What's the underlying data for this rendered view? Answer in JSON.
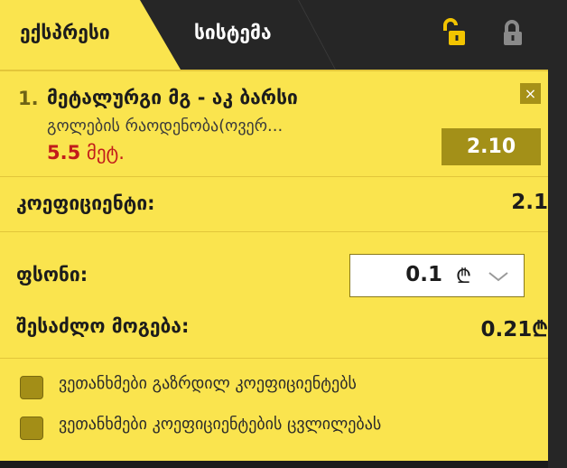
{
  "tabs": {
    "express": "ექსპრესი",
    "system": "სისტემა"
  },
  "icons": {
    "unlock": "unlock-icon",
    "lock": "lock-icon",
    "close": "close-icon",
    "chevron": "chevron-down-icon"
  },
  "colors": {
    "panel": "#fae44e",
    "dark": "#262626",
    "odds_box": "#a39018",
    "selection_red": "#c21b1b",
    "unlock_icon": "#f2c400",
    "lock_icon": "#8a8a8a"
  },
  "event": {
    "number": "1.",
    "title": "მეტალურგი მგ - აკ ბარსი",
    "market": "გოლების რაოდენობა(ოვერ...",
    "selection_value": "5.5",
    "selection_suffix": "მეტ.",
    "odds": "2.10",
    "close_label": "×"
  },
  "coefficient": {
    "label": "კოეფიციენტი:",
    "value": "2.1"
  },
  "stake": {
    "label": "ფსონი:",
    "value": "0.1",
    "currency": "₾"
  },
  "winnings": {
    "label": "შესაძლო მოგება:",
    "value": "0.21₾"
  },
  "options": [
    {
      "label": "ვეთანხმები გაზრდილ კოეფიციენტებს"
    },
    {
      "label": "ვეთანხმები კოეფიციენტების ცვლილებას"
    }
  ]
}
